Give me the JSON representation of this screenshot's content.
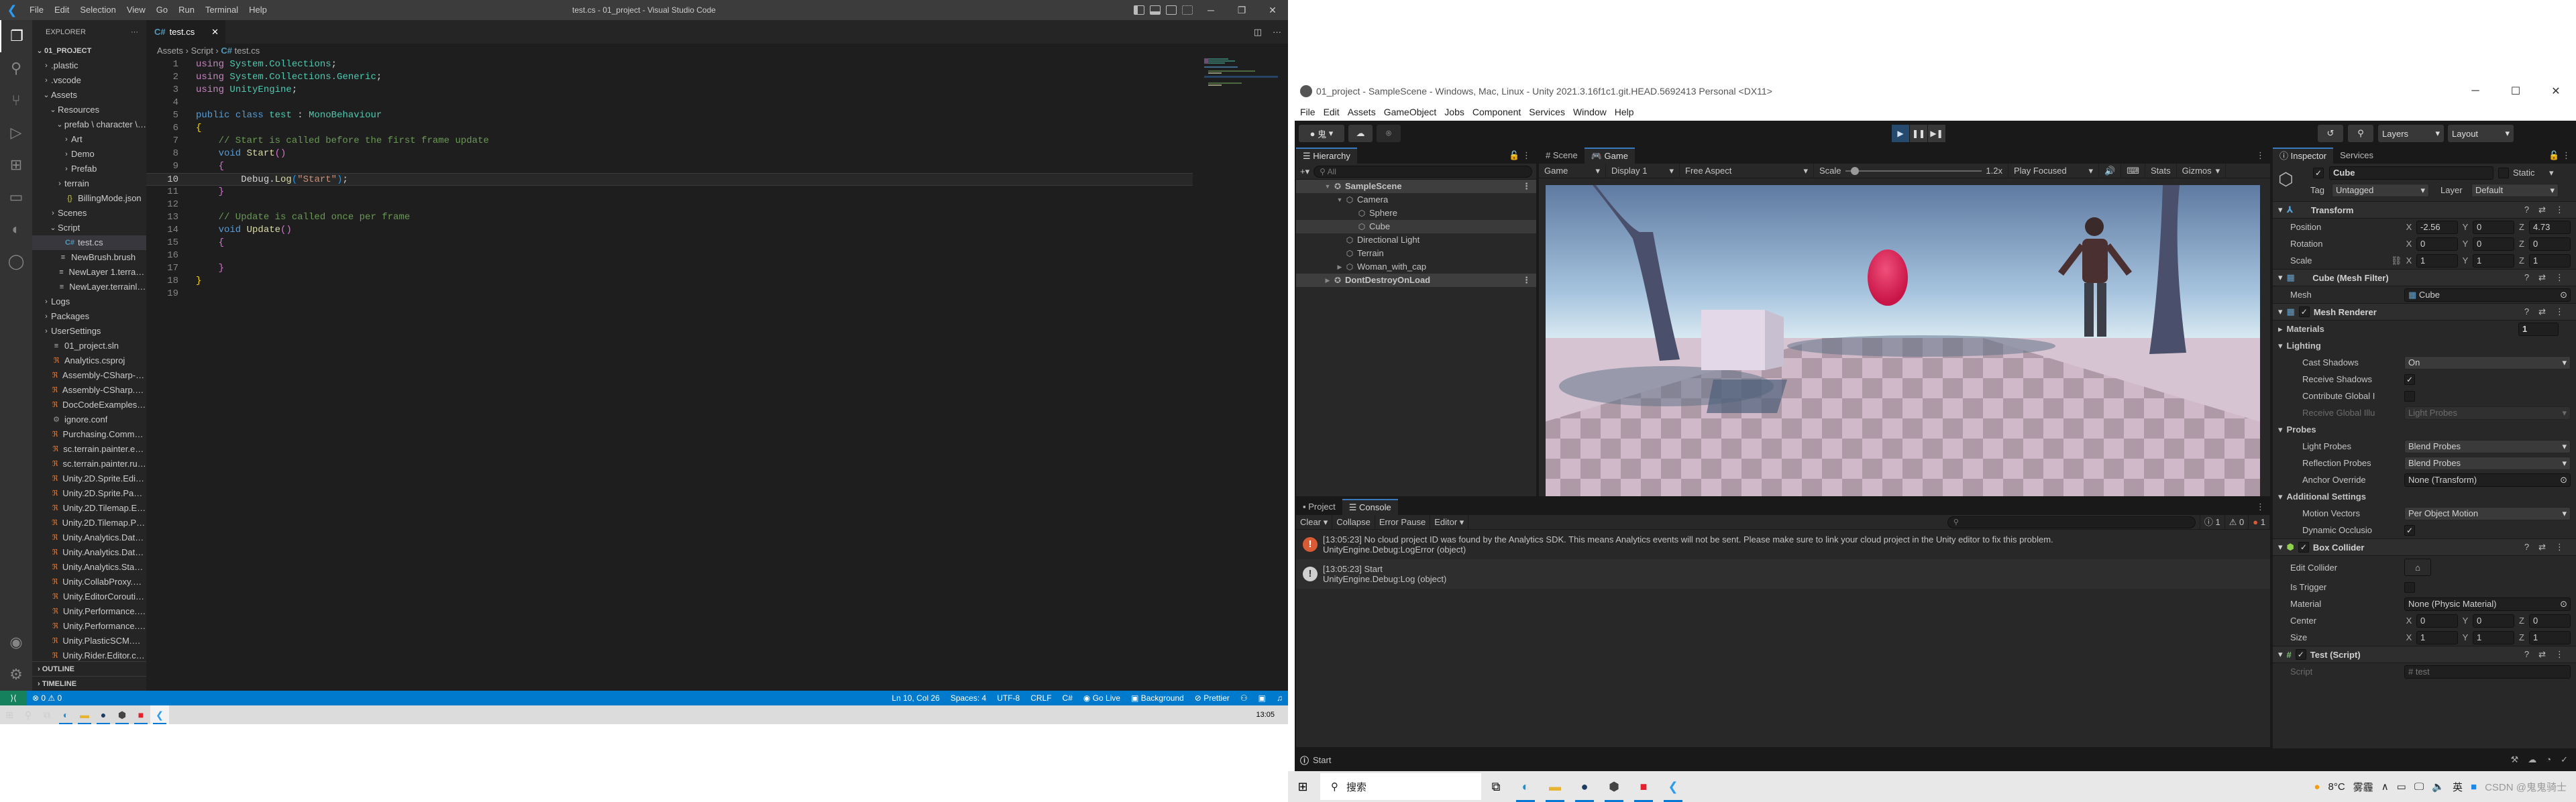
{
  "vscode": {
    "window_title": "test.cs - 01_project - Visual Studio Code",
    "menu": [
      "File",
      "Edit",
      "Selection",
      "View",
      "Go",
      "Run",
      "Terminal",
      "Help"
    ],
    "explorer": {
      "header": "EXPLORER",
      "root": "01_PROJECT",
      "items": [
        {
          "label": ".plastic",
          "depth": 1,
          "type": "folder",
          "open": false
        },
        {
          "label": ".vscode",
          "depth": 1,
          "type": "folder",
          "open": false
        },
        {
          "label": "Assets",
          "depth": 1,
          "type": "folder",
          "open": true
        },
        {
          "label": "Resources",
          "depth": 2,
          "type": "folder",
          "open": true
        },
        {
          "label": "prefab \\ character \\ ...",
          "depth": 3,
          "type": "folder",
          "open": true
        },
        {
          "label": "Art",
          "depth": 4,
          "type": "folder",
          "open": false
        },
        {
          "label": "Demo",
          "depth": 4,
          "type": "folder",
          "open": false
        },
        {
          "label": "Prefab",
          "depth": 4,
          "type": "folder",
          "open": false
        },
        {
          "label": "terrain",
          "depth": 3,
          "type": "folder",
          "open": false
        },
        {
          "label": "BillingMode.json",
          "depth": 3,
          "type": "json"
        },
        {
          "label": "Scenes",
          "depth": 2,
          "type": "folder",
          "open": false
        },
        {
          "label": "Script",
          "depth": 2,
          "type": "folder",
          "open": true
        },
        {
          "label": "test.cs",
          "depth": 3,
          "type": "cs",
          "selected": true
        },
        {
          "label": "NewBrush.brush",
          "depth": 2,
          "type": "txt"
        },
        {
          "label": "NewLayer 1.terrainla...",
          "depth": 2,
          "type": "txt"
        },
        {
          "label": "NewLayer.terrainlayer",
          "depth": 2,
          "type": "txt"
        },
        {
          "label": "Logs",
          "depth": 1,
          "type": "folder",
          "open": false
        },
        {
          "label": "Packages",
          "depth": 1,
          "type": "folder",
          "open": false
        },
        {
          "label": "UserSettings",
          "depth": 1,
          "type": "folder",
          "open": false
        },
        {
          "label": "01_project.sln",
          "depth": 1,
          "type": "txt"
        },
        {
          "label": "Analytics.csproj",
          "depth": 1,
          "type": "rss"
        },
        {
          "label": "Assembly-CSharp-Edi...",
          "depth": 1,
          "type": "rss"
        },
        {
          "label": "Assembly-CSharp.csp...",
          "depth": 1,
          "type": "rss"
        },
        {
          "label": "DocCodeExamples.cs...",
          "depth": 1,
          "type": "rss"
        },
        {
          "label": "ignore.conf",
          "depth": 1,
          "type": "gear"
        },
        {
          "label": "Purchasing.Common....",
          "depth": 1,
          "type": "rss"
        },
        {
          "label": "sc.terrain.painter.edit...",
          "depth": 1,
          "type": "rss"
        },
        {
          "label": "sc.terrain.painter.runti...",
          "depth": 1,
          "type": "rss"
        },
        {
          "label": "Unity.2D.Sprite.Editor....",
          "depth": 1,
          "type": "rss"
        },
        {
          "label": "Unity.2D.Sprite.Packa...",
          "depth": 1,
          "type": "rss"
        },
        {
          "label": "Unity.2D.Tilemap.Edit...",
          "depth": 1,
          "type": "rss"
        },
        {
          "label": "Unity.2D.Tilemap.Pack...",
          "depth": 1,
          "type": "rss"
        },
        {
          "label": "Unity.Analytics.DataPr...",
          "depth": 1,
          "type": "rss"
        },
        {
          "label": "Unity.Analytics.DataPr...",
          "depth": 1,
          "type": "rss"
        },
        {
          "label": "Unity.Analytics.Standa...",
          "depth": 1,
          "type": "rss"
        },
        {
          "label": "Unity.CollabProxy.Edit...",
          "depth": 1,
          "type": "rss"
        },
        {
          "label": "Unity.EditorCoroutine...",
          "depth": 1,
          "type": "rss"
        },
        {
          "label": "Unity.Performance.Pr...",
          "depth": 1,
          "type": "rss"
        },
        {
          "label": "Unity.Performance.Pr...",
          "depth": 1,
          "type": "rss"
        },
        {
          "label": "Unity.PlasticSCM.Edit...",
          "depth": 1,
          "type": "rss"
        },
        {
          "label": "Unity.Rider.Editor.cspr...",
          "depth": 1,
          "type": "rss"
        }
      ],
      "sections": [
        "OUTLINE",
        "TIMELINE"
      ]
    },
    "tab": {
      "label": "test.cs"
    },
    "breadcrumb": [
      "Assets",
      "Script",
      "test.cs"
    ],
    "code_lines": [
      [
        {
          "t": "using ",
          "c": "kw"
        },
        {
          "t": "System.Collections",
          "c": "ty"
        },
        {
          "t": ";",
          "c": "pu"
        }
      ],
      [
        {
          "t": "using ",
          "c": "kw"
        },
        {
          "t": "System.Collections.Generic",
          "c": "ty"
        },
        {
          "t": ";",
          "c": "pu"
        }
      ],
      [
        {
          "t": "using ",
          "c": "kw"
        },
        {
          "t": "UnityEngine",
          "c": "ty"
        },
        {
          "t": ";",
          "c": "pu"
        }
      ],
      [],
      [
        {
          "t": "public ",
          "c": "kb"
        },
        {
          "t": "class ",
          "c": "kb"
        },
        {
          "t": "test",
          "c": "ty"
        },
        {
          "t": " : ",
          "c": "pu"
        },
        {
          "t": "MonoBehaviour",
          "c": "ty"
        }
      ],
      [
        {
          "t": "{",
          "c": "br1"
        }
      ],
      [
        {
          "t": "    // Start is called before the first frame update",
          "c": "cm"
        }
      ],
      [
        {
          "t": "    void ",
          "c": "kb"
        },
        {
          "t": "Start",
          "c": "fn"
        },
        {
          "t": "()",
          "c": "br2"
        }
      ],
      [
        {
          "t": "    {",
          "c": "br2"
        }
      ],
      [
        {
          "t": "        Debug",
          "c": "pu"
        },
        {
          "t": ".",
          "c": "pu"
        },
        {
          "t": "Log",
          "c": "fn"
        },
        {
          "t": "(",
          "c": "br3"
        },
        {
          "t": "\"Start\"",
          "c": "st"
        },
        {
          "t": ")",
          "c": "br3"
        },
        {
          "t": ";",
          "c": "pu"
        }
      ],
      [
        {
          "t": "    }",
          "c": "br2"
        }
      ],
      [],
      [
        {
          "t": "    // Update is called once per frame",
          "c": "cm"
        }
      ],
      [
        {
          "t": "    void ",
          "c": "kb"
        },
        {
          "t": "Update",
          "c": "fn"
        },
        {
          "t": "()",
          "c": "br2"
        }
      ],
      [
        {
          "t": "    {",
          "c": "br2"
        }
      ],
      [],
      [
        {
          "t": "    }",
          "c": "br2"
        }
      ],
      [
        {
          "t": "}",
          "c": "br1"
        }
      ],
      []
    ],
    "current_line": 10,
    "status": {
      "errors": "0",
      "warnings": "0",
      "cursor": "Ln 10, Col 26",
      "spaces": "Spaces: 4",
      "encoding": "UTF-8",
      "eol": "CRLF",
      "language": "C#",
      "go_live": "Go Live",
      "background": "Background",
      "prettier": "Prettier"
    }
  },
  "taskbar_left": {
    "clock": "13:05"
  },
  "unity": {
    "window_title": "01_project - SampleScene - Windows, Mac, Linux - Unity 2021.3.16f1c1.git.HEAD.5692413 Personal <DX11>",
    "menu": [
      "File",
      "Edit",
      "Assets",
      "GameObject",
      "Jobs",
      "Component",
      "Services",
      "Window",
      "Help"
    ],
    "toolbar": {
      "account": "鬼",
      "layers": "Layers",
      "layout": "Layout"
    },
    "hierarchy": {
      "tab": "Hierarchy",
      "search_placeholder": "All",
      "rows": [
        {
          "label": "SampleScene",
          "depth": 0,
          "kind": "scene",
          "open": true
        },
        {
          "label": "Camera",
          "depth": 1,
          "kind": "obj",
          "open": true
        },
        {
          "label": "Sphere",
          "depth": 2,
          "kind": "obj"
        },
        {
          "label": "Cube",
          "depth": 2,
          "kind": "obj",
          "selected": true
        },
        {
          "label": "Directional Light",
          "depth": 1,
          "kind": "obj"
        },
        {
          "label": "Terrain",
          "depth": 1,
          "kind": "obj"
        },
        {
          "label": "Woman_with_cap",
          "depth": 1,
          "kind": "obj",
          "open": false
        },
        {
          "label": "DontDestroyOnLoad",
          "depth": 0,
          "kind": "scene",
          "open": false
        }
      ]
    },
    "game_view": {
      "tabs": [
        "Scene",
        "Game"
      ],
      "active_tab": "Game",
      "mode": "Game",
      "display": "Display 1",
      "aspect": "Free Aspect",
      "scale_label": "Scale",
      "scale_value": "1.2x",
      "play_mode": "Play Focused",
      "stats": "Stats",
      "gizmos": "Gizmos"
    },
    "inspector": {
      "tabs": [
        "Inspector",
        "Services"
      ],
      "object_name": "Cube",
      "static_label": "Static",
      "tag_label": "Tag",
      "tag": "Untagged",
      "layer_label": "Layer",
      "layer": "Default",
      "transform": {
        "title": "Transform",
        "position": {
          "label": "Position",
          "x": "-2.56",
          "y": "0",
          "z": "4.73"
        },
        "rotation": {
          "label": "Rotation",
          "x": "0",
          "y": "0",
          "z": "0"
        },
        "scale": {
          "label": "Scale",
          "x": "1",
          "y": "1",
          "z": "1"
        }
      },
      "mesh_filter": {
        "title": "Cube (Mesh Filter)",
        "mesh_label": "Mesh",
        "mesh": "Cube"
      },
      "mesh_renderer": {
        "title": "Mesh Renderer",
        "materials_label": "Materials",
        "materials_count": "1",
        "lighting": "Lighting",
        "cast_shadows_label": "Cast Shadows",
        "cast_shadows": "On",
        "receive_shadows_label": "Receive Shadows",
        "contribute_gi_label": "Contribute Global I",
        "receive_gi_label": "Receive Global Illu",
        "receive_gi": "Light Probes",
        "probes": "Probes",
        "light_probes_label": "Light Probes",
        "light_probes": "Blend Probes",
        "reflection_probes_label": "Reflection Probes",
        "reflection_probes": "Blend Probes",
        "anchor_override_label": "Anchor Override",
        "anchor_override": "None (Transform)",
        "additional": "Additional Settings",
        "motion_vectors_label": "Motion Vectors",
        "motion_vectors": "Per Object Motion",
        "dynamic_occlusion_label": "Dynamic Occlusio"
      },
      "box_collider": {
        "title": "Box Collider",
        "edit_collider_label": "Edit Collider",
        "is_trigger_label": "Is Trigger",
        "material_label": "Material",
        "material": "None (Physic Material)",
        "center": {
          "label": "Center",
          "x": "0",
          "y": "0",
          "z": "0"
        },
        "size": {
          "label": "Size",
          "x": "1",
          "y": "1",
          "z": "1"
        }
      },
      "script": {
        "title": "Test (Script)",
        "script_label": "Script",
        "script": "test"
      }
    },
    "console": {
      "tabs": [
        "Project",
        "Console"
      ],
      "active_tab": "Console",
      "buttons": [
        "Clear",
        "Collapse",
        "Error Pause",
        "Editor"
      ],
      "counts": {
        "log": "1",
        "warning": "0",
        "error": "1"
      },
      "messages": [
        {
          "level": "error",
          "line1": "[13:05:23] No cloud project ID was found by the Analytics SDK. This means Analytics events will not be sent. Please make sure to link your cloud project in the Unity editor to fix this problem.",
          "line2": "UnityEngine.Debug:LogError (object)"
        },
        {
          "level": "log",
          "line1": "[13:05:23] Start",
          "line2": "UnityEngine.Debug:Log (object)"
        }
      ]
    },
    "status_bar": "Start"
  },
  "taskbar_right": {
    "search": "搜索",
    "weather": "8°C",
    "weather_desc": "雾霾",
    "ime": "英",
    "watermark": "CSDN @鬼鬼骑士"
  }
}
